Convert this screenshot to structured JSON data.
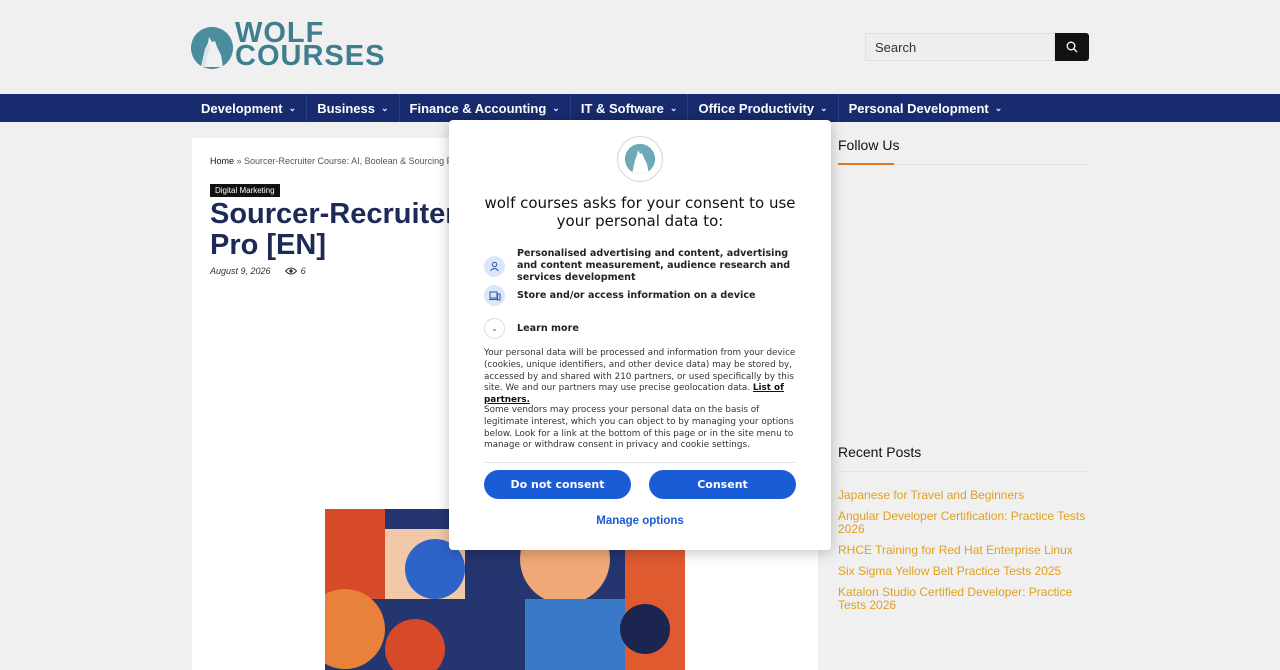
{
  "header": {
    "logo_line1": "WOLF",
    "logo_line2": "COURSES",
    "search_placeholder": "Search"
  },
  "nav": {
    "items": [
      {
        "label": "Development"
      },
      {
        "label": "Business"
      },
      {
        "label": "Finance & Accounting"
      },
      {
        "label": "IT & Software"
      },
      {
        "label": "Office Productivity"
      },
      {
        "label": "Personal Development"
      }
    ]
  },
  "post": {
    "breadcrumb_home": "Home",
    "breadcrumb_sep": " » ",
    "breadcrumb_current": "Sourcer-Recruiter Course: AI, Boolean & Sourcing Pr",
    "category": "Digital Marketing",
    "title_line1": "Sourcer-Recruiter Co",
    "title_line2": "Pro [EN]",
    "date": "August 9, 2026",
    "views": "6"
  },
  "sidebar": {
    "follow_title": "Follow Us",
    "recent_title": "Recent Posts",
    "recent_posts": [
      "Japanese for Travel and Beginners",
      "Angular Developer Certification: Practice Tests 2026",
      "RHCE Training for Red Hat Enterprise Linux",
      "Six Sigma Yellow Belt Practice Tests 2025",
      "Katalon Studio Certified Developer: Practice Tests 2026"
    ]
  },
  "consent": {
    "title": "wolf courses asks for your consent to use your personal data to:",
    "purpose1": "Personalised advertising and content, advertising and content measurement, audience research and services development",
    "purpose2": "Store and/or access information on a device",
    "learn_more": "Learn more",
    "para1": "Your personal data will be processed and information from your device (cookies, unique identifiers, and other device data) may be stored by, accessed by and shared with 210 partners, or used specifically by this site. We and our partners may use precise geolocation data.",
    "partners_link": "List of partners.",
    "para2": "Some vendors may process your personal data on the basis of legitimate interest, which you can object to by managing your options below. Look for a link at the bottom of this page or in the site menu to manage or withdraw consent in privacy and cookie settings.",
    "do_not_consent": "Do not consent",
    "consent": "Consent",
    "manage_options": "Manage options"
  },
  "colors": {
    "nav_bg": "#172b6e",
    "logo_teal": "#3f7e8e",
    "accent_orange": "#e07820",
    "recent_link": "#e0a020",
    "consent_blue": "#1a5bd6"
  }
}
